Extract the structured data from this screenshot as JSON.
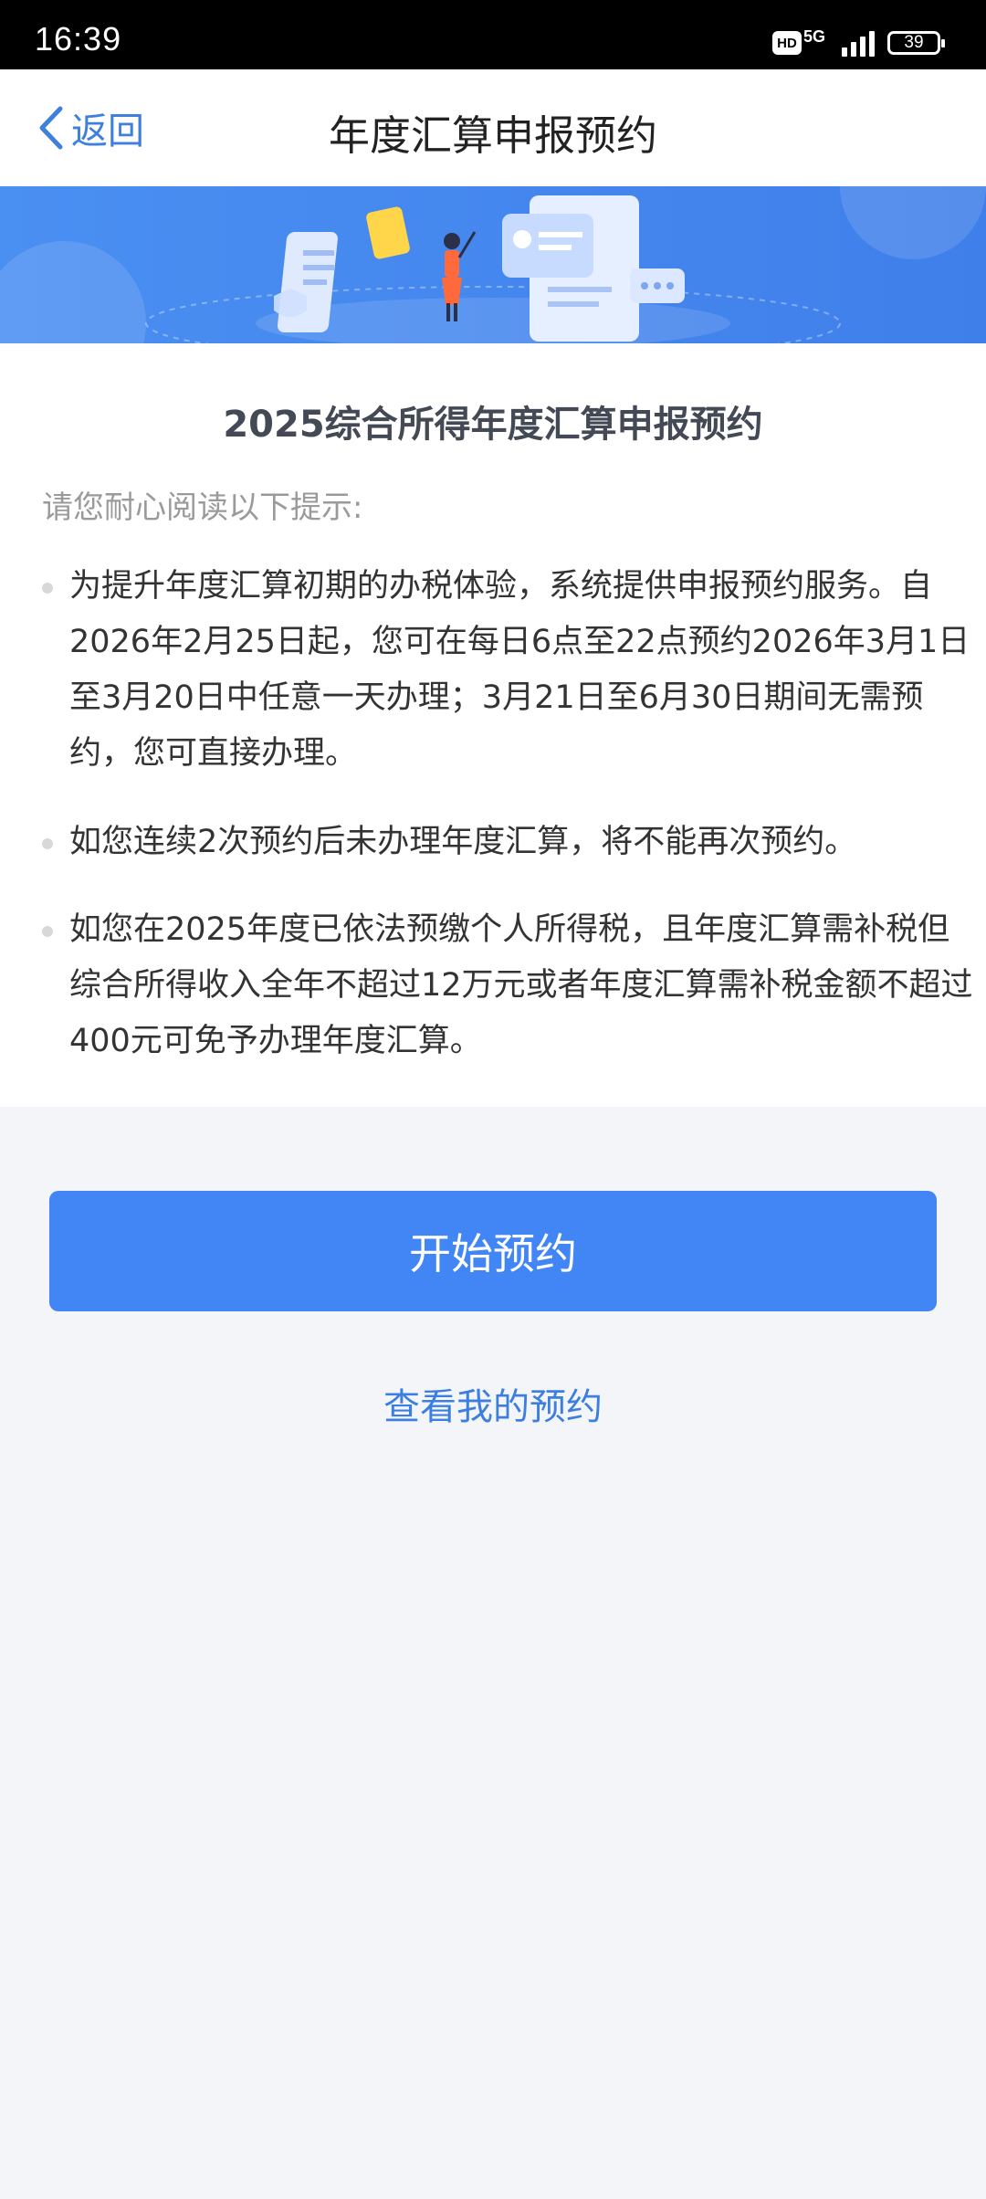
{
  "status_bar": {
    "time": "16:39",
    "hd": "HD",
    "network": "5G",
    "battery": "39"
  },
  "header": {
    "back_label": "返回",
    "title": "年度汇算申报预约"
  },
  "main": {
    "title": "2025综合所得年度汇算申报预约",
    "hint_intro": "请您耐心阅读以下提示:",
    "tips": [
      "为提升年度汇算初期的办税体验，系统提供申报预约服务。自2026年2月25日起，您可在每日6点至22点预约2026年3月1日至3月20日中任意一天办理；3月21日至6月30日期间无需预约，您可直接办理。",
      "如您连续2次预约后未办理年度汇算，将不能再次预约。",
      "如您在2025年度已依法预缴个人所得税，且年度汇算需补税但综合所得收入全年不超过12万元或者年度汇算需补税金额不超过400元可免予办理年度汇算。"
    ]
  },
  "actions": {
    "start_label": "开始预约",
    "view_label": "查看我的预约"
  },
  "colors": {
    "primary": "#4286f5",
    "link": "#3d7fe0",
    "banner": "#4a8ef0"
  }
}
